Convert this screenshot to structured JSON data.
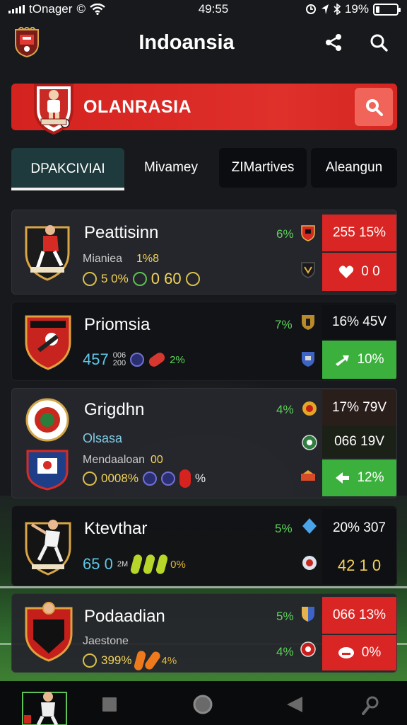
{
  "status_bar": {
    "carrier": "tOnager",
    "time": "49:55",
    "battery": "19%",
    "battery_level": 0.19
  },
  "app_bar": {
    "title": "Indoansia",
    "share_icon": "share-icon",
    "search_icon": "search-icon"
  },
  "banner": {
    "title": "OLANRASIA",
    "action_icon": "search-icon"
  },
  "tabs": [
    {
      "label": "DPAKCIVIAI",
      "active": true
    },
    {
      "label": "Mivamey",
      "active": false
    },
    {
      "label": "ZIMartives",
      "active": false
    },
    {
      "label": "Aleangun",
      "active": false
    }
  ],
  "players": [
    {
      "name": "Peattisinn",
      "sub": "Mianiea",
      "sub_extra": "1%8",
      "stat1": "5 0%",
      "stat2": "0 60",
      "pct": "6%",
      "pill_top": "255 15%",
      "pill_bottom": "0 0"
    },
    {
      "name": "Priomsia",
      "stat1": "457",
      "stat_small_a": "006",
      "stat_small_b": "200",
      "stat2": "2%",
      "pct": "7%",
      "pill_top": "16% 45V",
      "pill_bottom": "10%"
    },
    {
      "name": "Grigdhn",
      "sub": "Olsasa",
      "sub2": "Mendaaloan",
      "sub2_extra": "00",
      "stat1": "0008%",
      "stat2": "%",
      "pct": "4%",
      "pill_top": "17% 79V",
      "pill_mid": "066 19V",
      "pill_bottom": "12%"
    },
    {
      "name": "Ktevthar",
      "stat1": "65 0",
      "stat_small": "2M",
      "stat2": "0%",
      "pct": "5%",
      "pill_top": "20% 307",
      "pill_bottom": "42 1 0"
    },
    {
      "name": "Podaadian",
      "sub": "Jaestone",
      "stat1": "399%",
      "stat2": "4%",
      "pct_top": "5%",
      "pct_bottom": "4%",
      "pill_top": "066 13%",
      "pill_bottom": "0%"
    }
  ],
  "colors": {
    "accent_red": "#d92624",
    "accent_green": "#3bb03d",
    "pct_green": "#5ed45a",
    "stat_yellow": "#f3d35b",
    "tab_active": "#1e3a3c"
  },
  "bottom_nav": [
    {
      "icon": "player-avatar-icon"
    },
    {
      "icon": "square-icon"
    },
    {
      "icon": "circle-icon"
    },
    {
      "icon": "back-triangle-icon"
    },
    {
      "icon": "profile-icon"
    }
  ]
}
